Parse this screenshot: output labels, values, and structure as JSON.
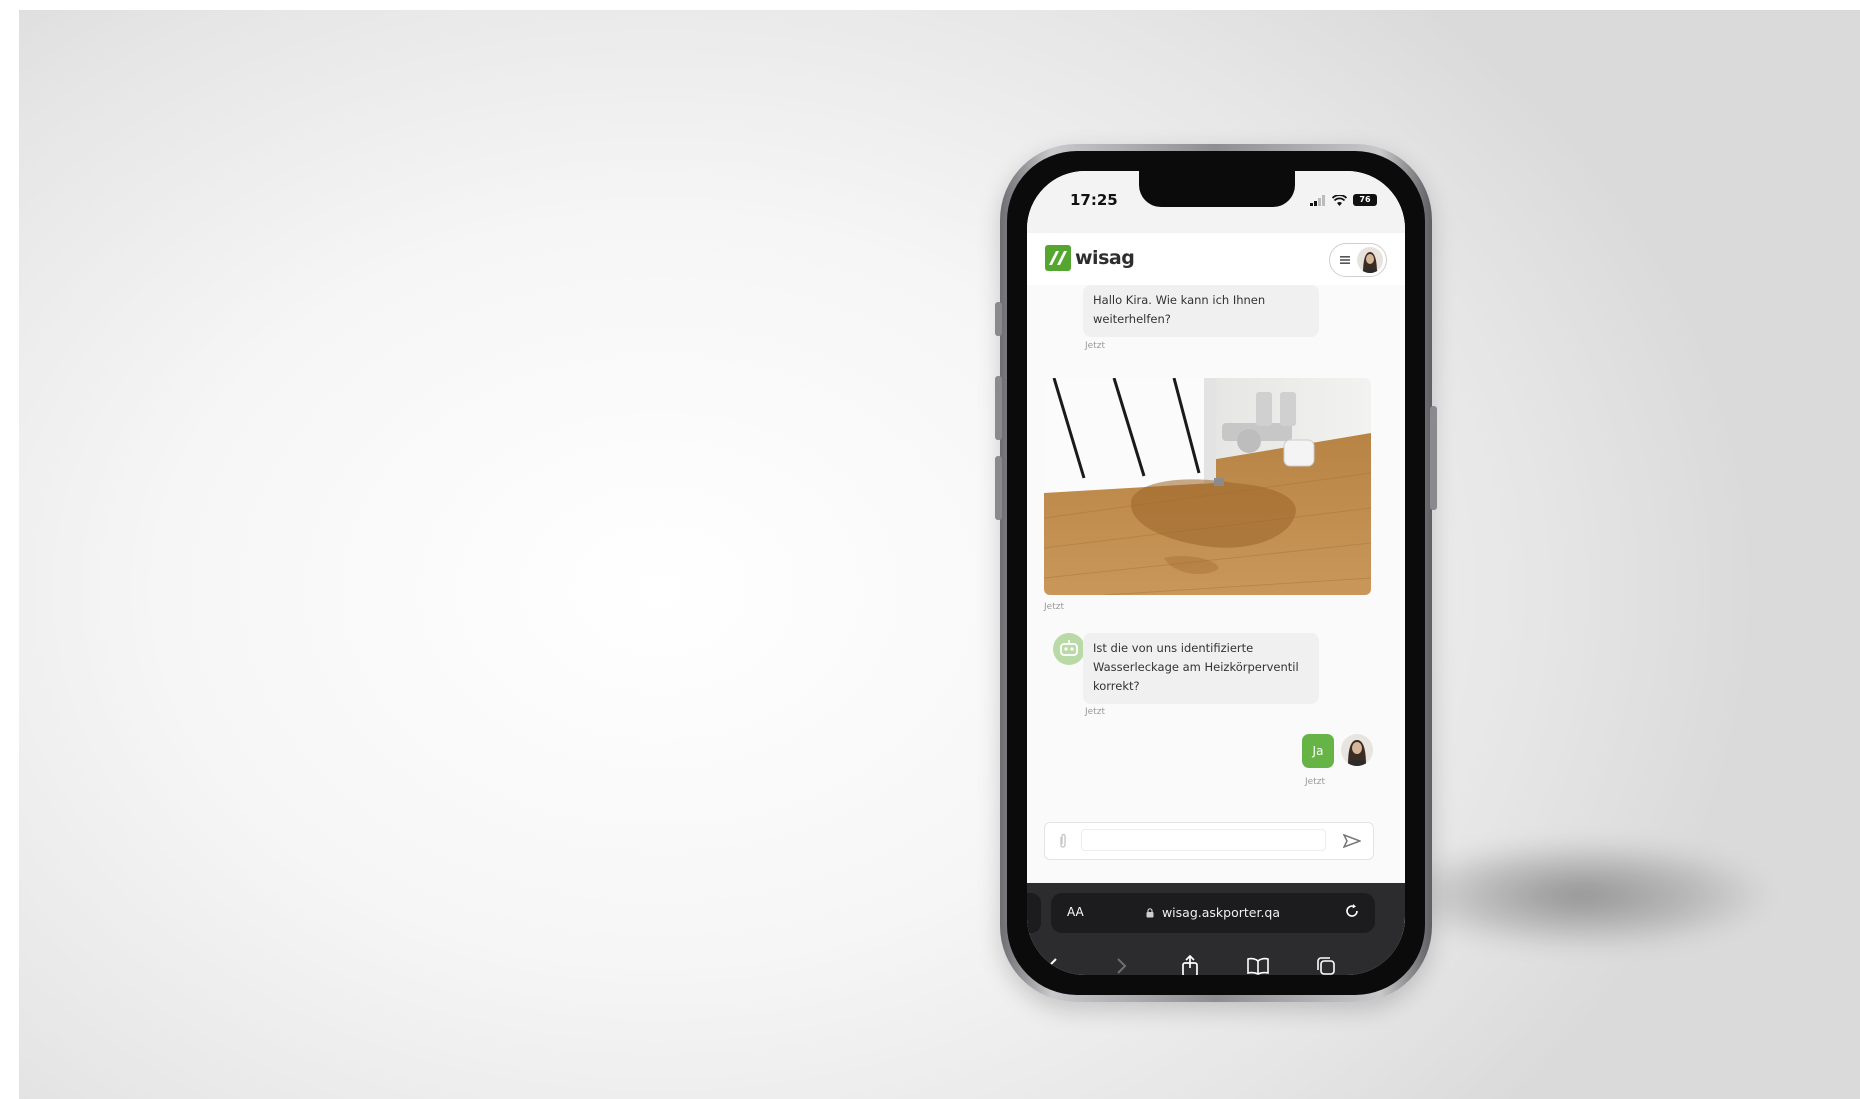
{
  "status_bar": {
    "time": "17:25",
    "battery_label": "76"
  },
  "header": {
    "logo_text": "wisag",
    "brand_color": "#55a630"
  },
  "chat": {
    "messages": [
      {
        "sender": "bot",
        "text_line1": "Hallo Kira. Wie kann ich Ihnen",
        "text_line2": "weiterhelfen?",
        "timestamp": "Jetzt"
      },
      {
        "sender": "user",
        "type": "image",
        "timestamp": "Jetzt"
      },
      {
        "sender": "bot",
        "text_line1": "Ist die von uns identifizierte",
        "text_line2": "Wasserleckage am Heizkörperventil",
        "text_line3": "korrekt?",
        "timestamp": "Jetzt"
      },
      {
        "sender": "user",
        "text": "Ja",
        "timestamp": "Jetzt"
      }
    ]
  },
  "composer": {
    "value": "",
    "attach_icon": "paperclip-icon",
    "send_icon": "send-icon"
  },
  "browser": {
    "aa_label": "AA",
    "url": "wisag.askporter.qa"
  }
}
